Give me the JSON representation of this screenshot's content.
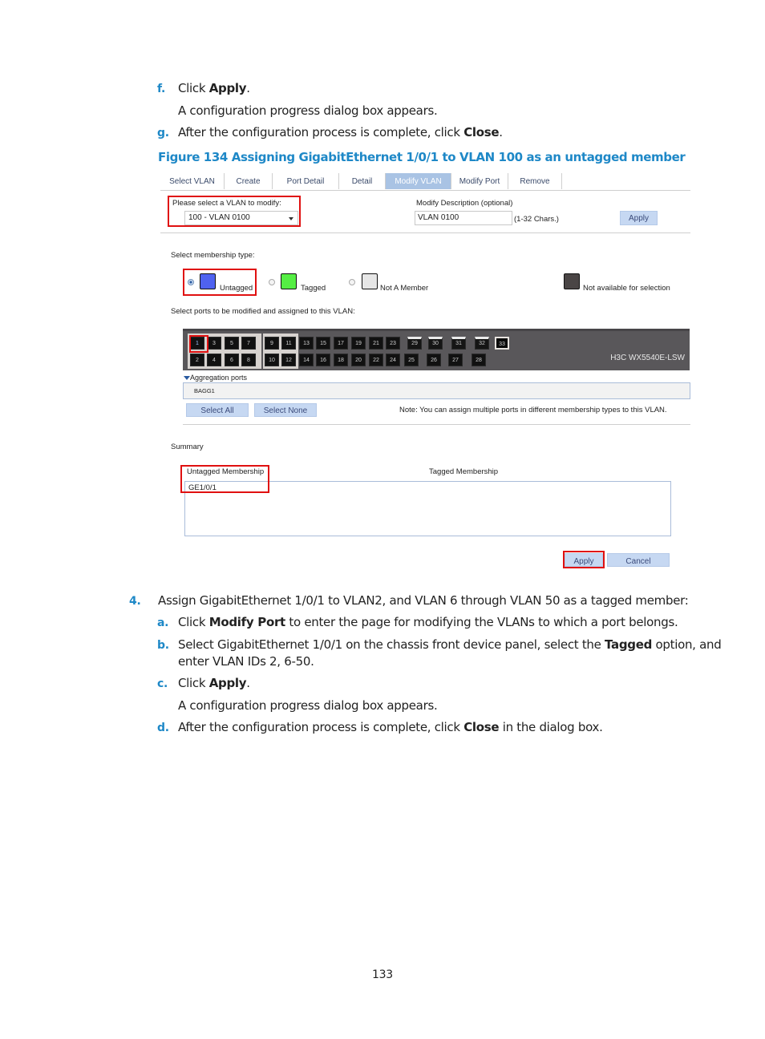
{
  "doc": {
    "steps_top": [
      {
        "marker": "f.",
        "pre": "Click ",
        "bold": "Apply",
        "post": "."
      },
      {
        "marker": "",
        "pre": "A configuration progress dialog box appears.",
        "bold": "",
        "post": ""
      },
      {
        "marker": "g.",
        "pre": "After the configuration process is complete, click ",
        "bold": "Close",
        "post": "."
      }
    ],
    "figure_caption": "Figure 134 Assigning GigabitEthernet 1/0/1 to VLAN 100 as an untagged member",
    "step4": {
      "marker": "4.",
      "text": "Assign GigabitEthernet 1/0/1 to VLAN2, and VLAN 6 through VLAN 50 as a tagged member:",
      "substeps": [
        {
          "marker": "a.",
          "pre": "Click ",
          "bold": "Modify Port",
          "post": " to enter the page for modifying the VLANs to which a port belongs."
        },
        {
          "marker": "b.",
          "pre": "Select GigabitEthernet 1/0/1 on the chassis front device panel, select the ",
          "bold": "Tagged",
          "post": " option, and"
        },
        {
          "marker": "",
          "pre": "enter VLAN IDs 2, 6-50.",
          "bold": "",
          "post": ""
        },
        {
          "marker": "c.",
          "pre": "Click ",
          "bold": "Apply",
          "post": "."
        },
        {
          "marker": "",
          "pre": "A configuration progress dialog box appears.",
          "bold": "",
          "post": ""
        },
        {
          "marker": "d.",
          "pre": "After the configuration process is complete, click ",
          "bold": "Close",
          "post": " in the dialog box."
        }
      ]
    },
    "page_number": "133"
  },
  "ui": {
    "tabs": [
      {
        "label": "Select VLAN",
        "active": false
      },
      {
        "label": "Create",
        "active": false
      },
      {
        "label": "Port Detail",
        "active": false
      },
      {
        "label": "Detail",
        "active": false
      },
      {
        "label": "Modify VLAN",
        "active": true
      },
      {
        "label": "Modify Port",
        "active": false
      },
      {
        "label": "Remove",
        "active": false
      }
    ],
    "vlan_select": {
      "label": "Please select a VLAN to modify:",
      "value": "100 - VLAN 0100"
    },
    "description": {
      "label": "Modify Description (optional)",
      "value": "VLAN 0100",
      "hint": "(1-32 Chars.)"
    },
    "apply_top": "Apply",
    "membership": {
      "label": "Select membership type:",
      "options": [
        {
          "label": "Untagged",
          "selected": true,
          "color": "#4f62f0"
        },
        {
          "label": "Tagged",
          "selected": false,
          "color": "#55ee44"
        },
        {
          "label": "Not A Member",
          "selected": false,
          "color": "#e6e6e6"
        }
      ],
      "unavailable": {
        "label": "Not available for selection",
        "color": "#4a4545"
      }
    },
    "ports_label": "Select ports to be modified and assigned to this VLAN:",
    "device_name": "H3C WX5540E-LSW",
    "ports_top": [
      "1",
      "3",
      "5",
      "7",
      "9",
      "11",
      "13",
      "15",
      "17",
      "19",
      "21",
      "23",
      "29",
      "30",
      "31",
      "32",
      "33"
    ],
    "ports_bottom": [
      "2",
      "4",
      "6",
      "8",
      "10",
      "12",
      "14",
      "16",
      "18",
      "20",
      "22",
      "24",
      "25",
      "26",
      "27",
      "28"
    ],
    "selected_port": "1",
    "aggregation": {
      "label": "Aggregation ports",
      "items": [
        "BAGG1"
      ]
    },
    "select_all": "Select All",
    "select_none": "Select None",
    "note": "Note: You can assign multiple ports in different membership types to this VLAN.",
    "summary": {
      "label": "Summary",
      "untagged_header": "Untagged Membership",
      "tagged_header": "Tagged Membership",
      "untagged_items": [
        "GE1/0/1"
      ],
      "tagged_items": []
    },
    "apply": "Apply",
    "cancel": "Cancel"
  }
}
